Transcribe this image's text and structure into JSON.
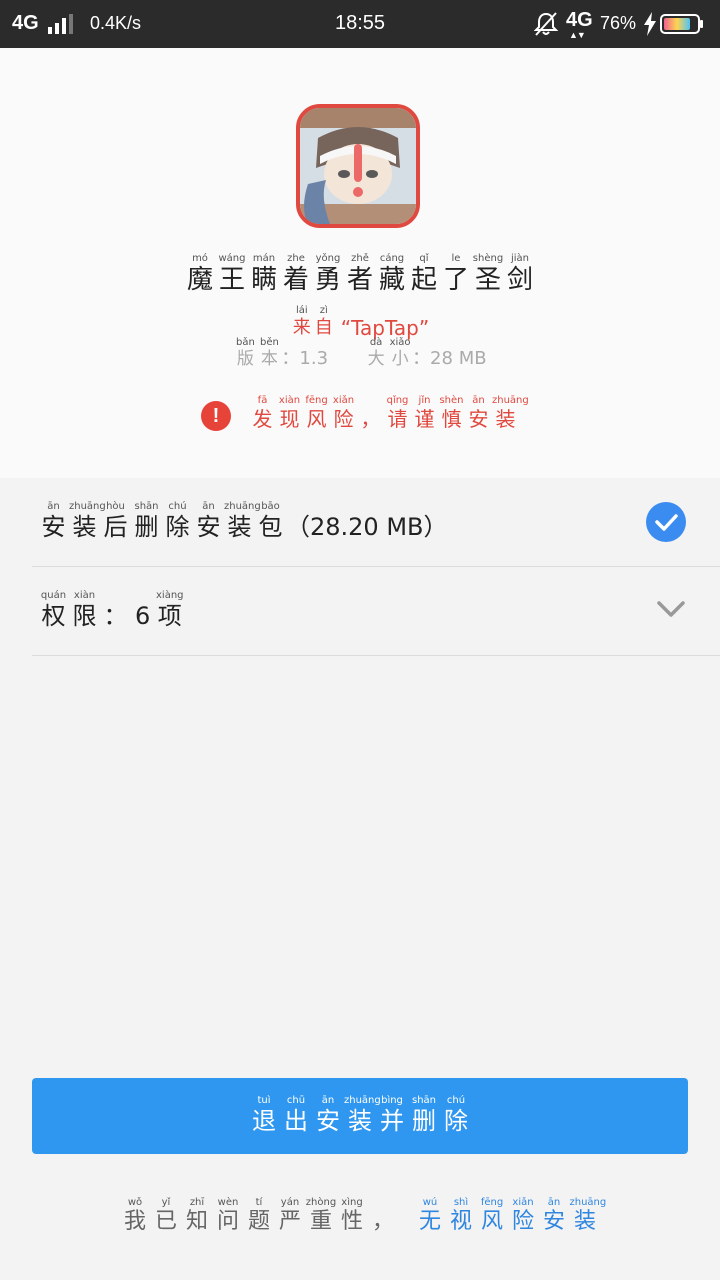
{
  "status_bar": {
    "network": "4G",
    "speed": "0.4K/s",
    "time": "18:55",
    "network2": "4G",
    "battery": "76%"
  },
  "app": {
    "title": [
      {
        "py": "mó",
        "hz": "魔"
      },
      {
        "py": "wáng",
        "hz": "王"
      },
      {
        "py": "mán",
        "hz": "瞒"
      },
      {
        "py": "zhe",
        "hz": "着"
      },
      {
        "py": "yǒng",
        "hz": "勇"
      },
      {
        "py": "zhě",
        "hz": "者"
      },
      {
        "py": "cáng",
        "hz": "藏"
      },
      {
        "py": "qǐ",
        "hz": "起"
      },
      {
        "py": "le",
        "hz": "了"
      },
      {
        "py": "shèng",
        "hz": "圣"
      },
      {
        "py": "jiàn",
        "hz": "剑"
      }
    ],
    "source_prefix": [
      {
        "py": "lái",
        "hz": "来"
      },
      {
        "py": "zì",
        "hz": "自"
      }
    ],
    "source_name": "“TapTap”",
    "version_label": [
      {
        "py": "bǎn",
        "hz": "版"
      },
      {
        "py": "běn",
        "hz": "本"
      }
    ],
    "version_value": "：1.3",
    "size_label": [
      {
        "py": "dà",
        "hz": "大"
      },
      {
        "py": "xiǎo",
        "hz": "小"
      }
    ],
    "size_value": "：28 MB"
  },
  "warning": {
    "icon": "exclamation-icon",
    "text": [
      {
        "py": "fā",
        "hz": "发"
      },
      {
        "py": "xiàn",
        "hz": "现"
      },
      {
        "py": "fēng",
        "hz": "风"
      },
      {
        "py": "xiǎn",
        "hz": "险"
      },
      {
        "py": "",
        "hz": "，"
      },
      {
        "py": "qǐng",
        "hz": "请"
      },
      {
        "py": "jǐn",
        "hz": "谨"
      },
      {
        "py": "shèn",
        "hz": "慎"
      },
      {
        "py": "ān",
        "hz": "安"
      },
      {
        "py": "zhuāng",
        "hz": "装"
      }
    ]
  },
  "options": {
    "delete_package": {
      "label": [
        {
          "py": "ān",
          "hz": "安"
        },
        {
          "py": "zhuāng",
          "hz": "装"
        },
        {
          "py": "hòu",
          "hz": "后"
        },
        {
          "py": "shān",
          "hz": "删"
        },
        {
          "py": "chú",
          "hz": "除"
        },
        {
          "py": "ān",
          "hz": "安"
        },
        {
          "py": "zhuāng",
          "hz": "装"
        },
        {
          "py": "bāo",
          "hz": "包"
        }
      ],
      "suffix": "（28.20 MB）",
      "checked": true
    },
    "permissions": {
      "label": [
        {
          "py": "quán",
          "hz": "权"
        },
        {
          "py": "xiàn",
          "hz": "限"
        },
        {
          "py": "",
          "hz": "："
        }
      ],
      "count": "6",
      "unit": [
        {
          "py": "xiàng",
          "hz": "项"
        }
      ]
    }
  },
  "primary_button": {
    "label": [
      {
        "py": "tuì",
        "hz": "退"
      },
      {
        "py": "chū",
        "hz": "出"
      },
      {
        "py": "ān",
        "hz": "安"
      },
      {
        "py": "zhuāng",
        "hz": "装"
      },
      {
        "py": "bìng",
        "hz": "并"
      },
      {
        "py": "shān",
        "hz": "删"
      },
      {
        "py": "chú",
        "hz": "除"
      }
    ]
  },
  "footer": {
    "text": [
      {
        "py": "wǒ",
        "hz": "我"
      },
      {
        "py": "yǐ",
        "hz": "已"
      },
      {
        "py": "zhī",
        "hz": "知"
      },
      {
        "py": "wèn",
        "hz": "问"
      },
      {
        "py": "tí",
        "hz": "题"
      },
      {
        "py": "yán",
        "hz": "严"
      },
      {
        "py": "zhòng",
        "hz": "重"
      },
      {
        "py": "xìng",
        "hz": "性"
      },
      {
        "py": "",
        "hz": "，"
      }
    ],
    "link": [
      {
        "py": "wú",
        "hz": "无"
      },
      {
        "py": "shì",
        "hz": "视"
      },
      {
        "py": "fēng",
        "hz": "风"
      },
      {
        "py": "xiǎn",
        "hz": "险"
      },
      {
        "py": "ān",
        "hz": "安"
      },
      {
        "py": "zhuāng",
        "hz": "装"
      }
    ]
  },
  "colors": {
    "accent": "#2f97ef",
    "danger": "#e0493f",
    "check": "#3b8cf0"
  }
}
